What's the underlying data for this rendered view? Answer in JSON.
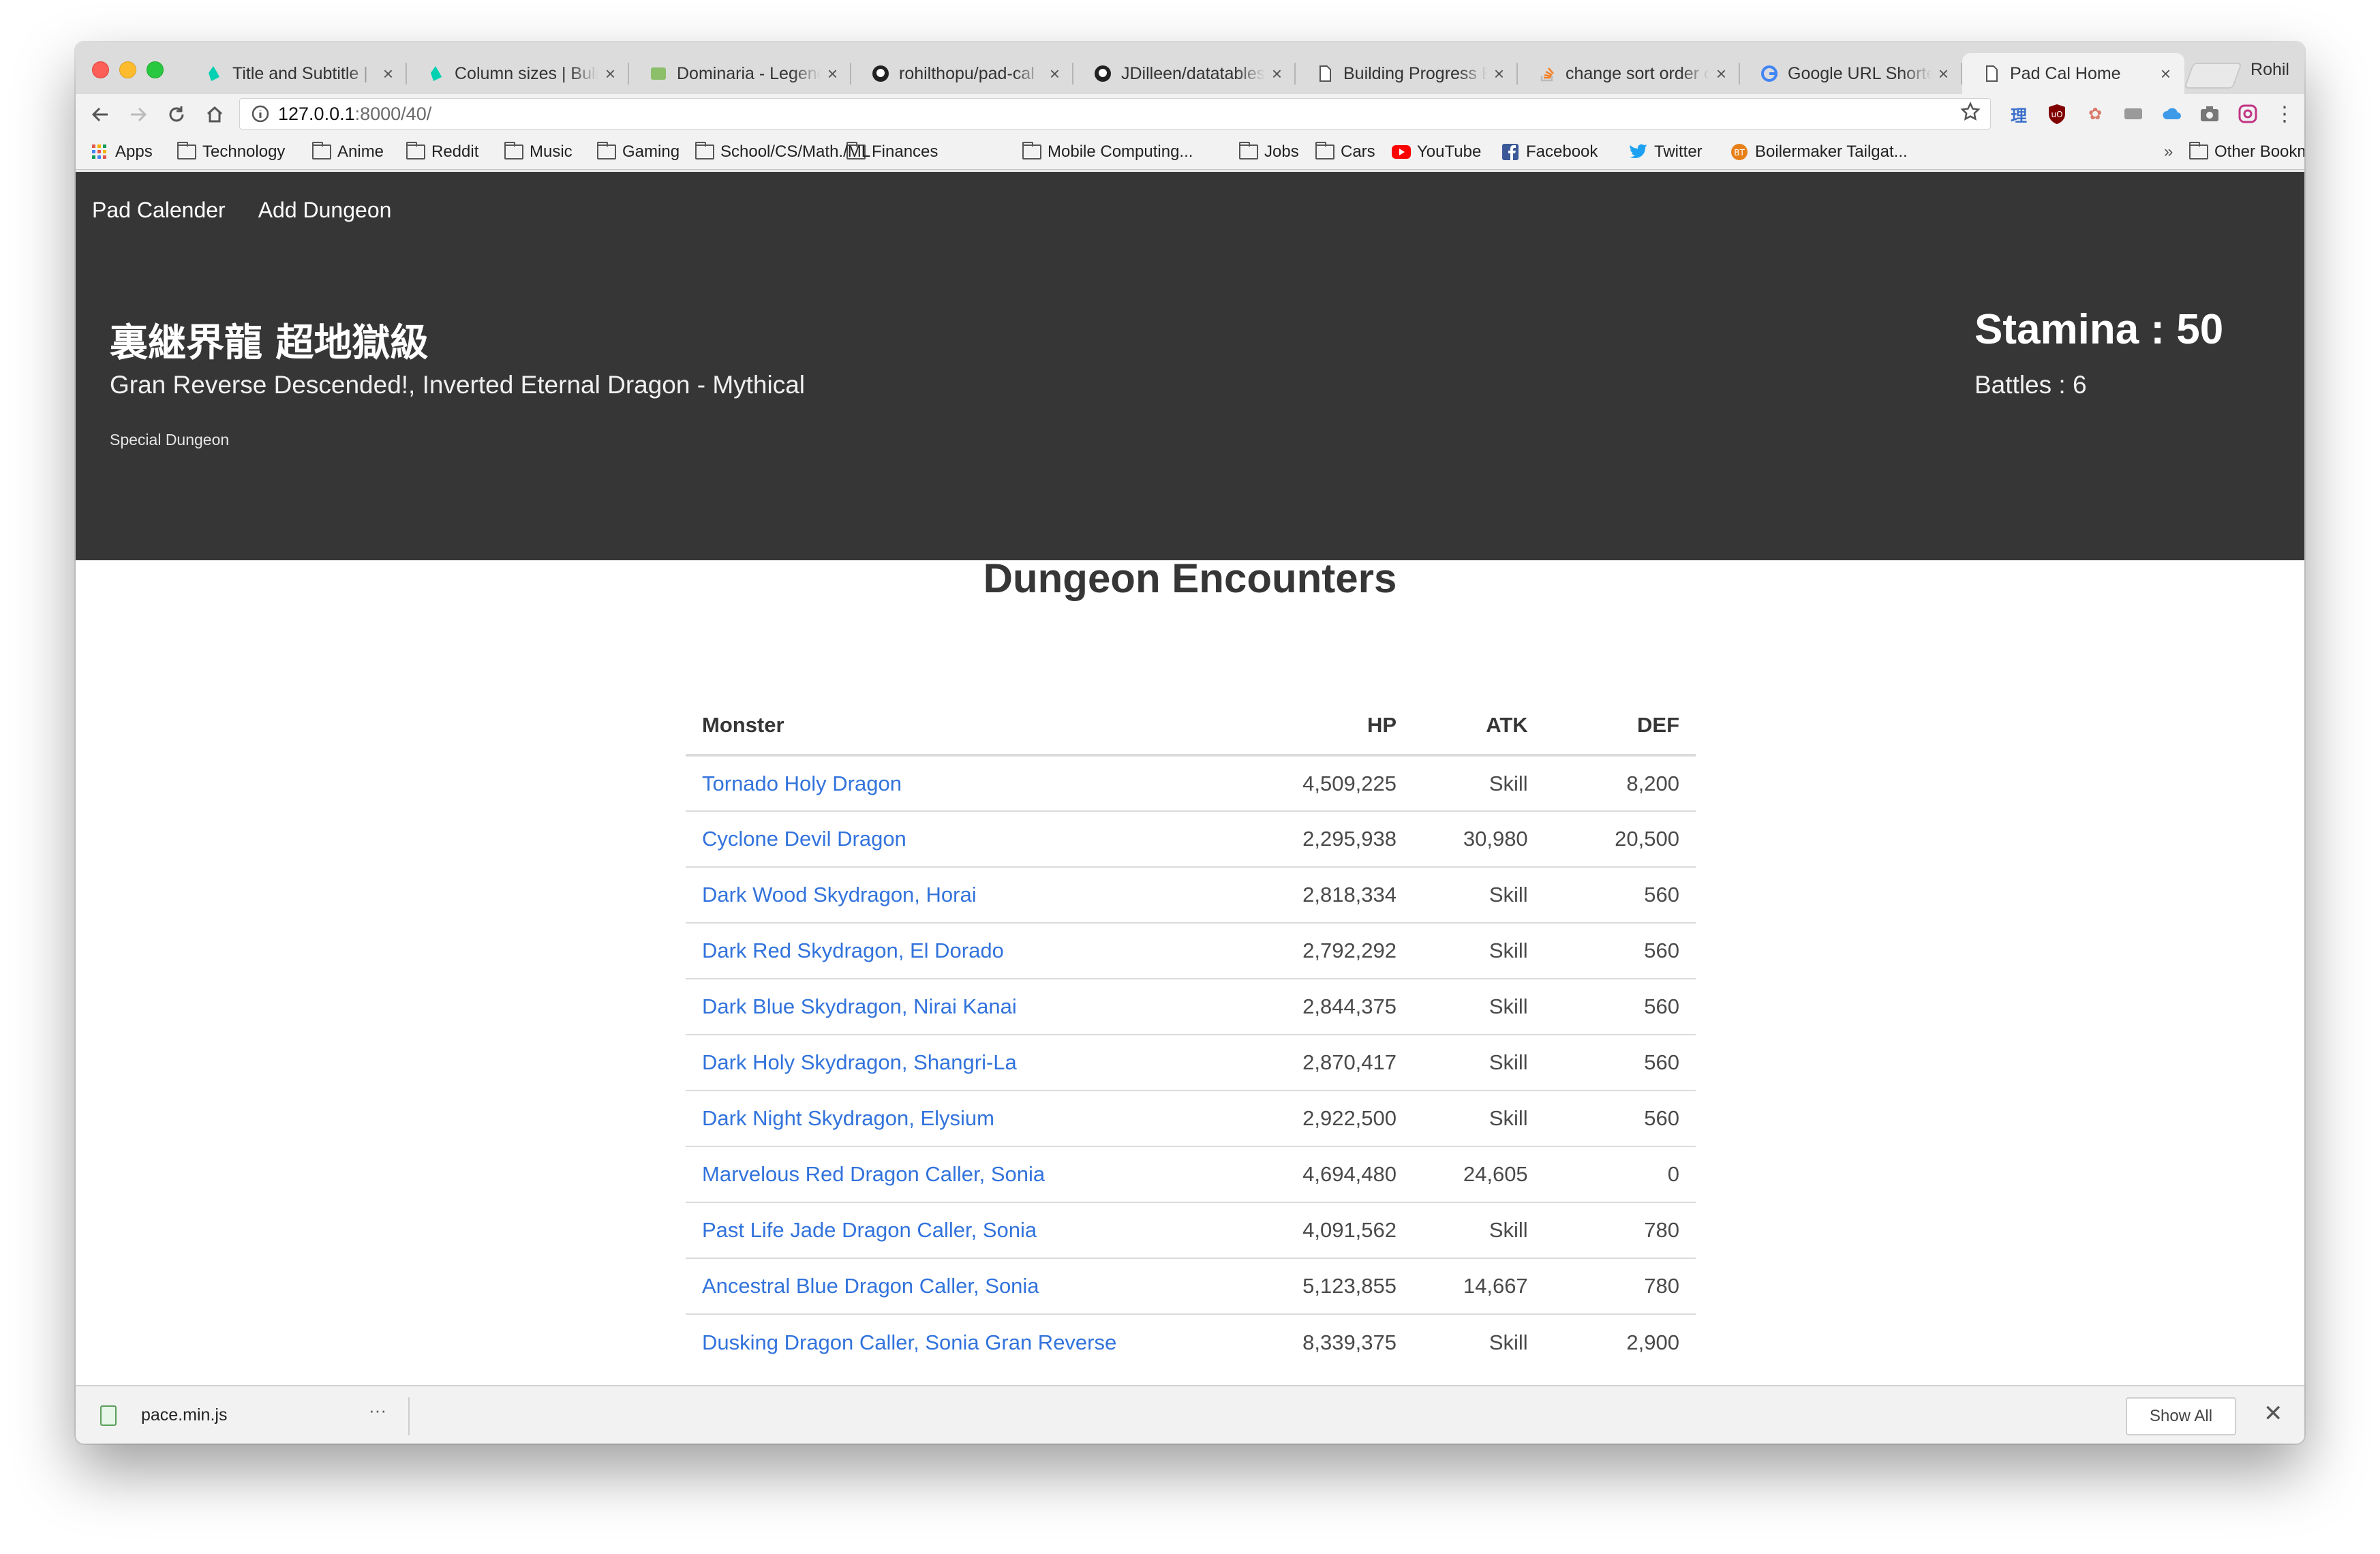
{
  "browser": {
    "profile_name": "Rohil",
    "tabs": [
      {
        "label": "Title and Subtitle |",
        "icon": "bulma-icon",
        "active": false
      },
      {
        "label": "Column sizes | Bulr",
        "icon": "bulma-icon",
        "active": false
      },
      {
        "label": "Dominaria - Legenc",
        "icon": "card-icon",
        "active": false
      },
      {
        "label": "rohilthopu/pad-cal",
        "icon": "github-icon",
        "active": false
      },
      {
        "label": "JDilleen/datatables",
        "icon": "github-icon",
        "active": false
      },
      {
        "label": "Building Progress E",
        "icon": "document-icon",
        "active": false
      },
      {
        "label": "change sort order c",
        "icon": "stackoverflow-icon",
        "active": false
      },
      {
        "label": "Google URL Shorte",
        "icon": "google-icon",
        "active": false
      },
      {
        "label": "Pad Cal Home",
        "icon": "document-icon",
        "active": true
      }
    ],
    "url_host": "127.0.0.1",
    "url_path": ":8000/40/",
    "bookmarks": [
      {
        "label": "Apps",
        "icon": "apps-grid-icon"
      },
      {
        "label": "Technology",
        "icon": "folder-icon"
      },
      {
        "label": "Anime",
        "icon": "folder-icon"
      },
      {
        "label": "Reddit",
        "icon": "folder-icon"
      },
      {
        "label": "Music",
        "icon": "folder-icon"
      },
      {
        "label": "Gaming",
        "icon": "folder-icon"
      },
      {
        "label": "School/CS/Math./ML",
        "icon": "folder-icon"
      },
      {
        "label": "Finances",
        "icon": "folder-icon"
      },
      {
        "label": "Mobile Computing...",
        "icon": "folder-icon"
      },
      {
        "label": "Jobs",
        "icon": "folder-icon"
      },
      {
        "label": "Cars",
        "icon": "folder-icon"
      },
      {
        "label": "YouTube",
        "icon": "youtube-icon"
      },
      {
        "label": "Facebook",
        "icon": "facebook-icon"
      },
      {
        "label": "Twitter",
        "icon": "twitter-icon"
      },
      {
        "label": "Boilermaker Tailgat...",
        "icon": "boilermaker-icon"
      }
    ],
    "bookmarks_overflow": "»",
    "other_bookmarks": "Other Bookmarks"
  },
  "nav": {
    "pad_calender": "Pad Calender",
    "add_dungeon": "Add Dungeon"
  },
  "hero": {
    "jp_title": "裏継界龍 超地獄級",
    "en_title": "Gran Reverse Descended!, Inverted Eternal Dragon - Mythical",
    "dungeon_type": "Special Dungeon",
    "stamina": "Stamina : 50",
    "battles": "Battles : 6"
  },
  "encounters": {
    "title": "Dungeon Encounters",
    "columns": [
      "Monster",
      "HP",
      "ATK",
      "DEF"
    ],
    "rows": [
      {
        "monster": "Tornado Holy Dragon",
        "hp": "4,509,225",
        "atk": "Skill",
        "def": "8,200"
      },
      {
        "monster": "Cyclone Devil Dragon",
        "hp": "2,295,938",
        "atk": "30,980",
        "def": "20,500"
      },
      {
        "monster": "Dark Wood Skydragon, Horai",
        "hp": "2,818,334",
        "atk": "Skill",
        "def": "560"
      },
      {
        "monster": "Dark Red Skydragon, El Dorado",
        "hp": "2,792,292",
        "atk": "Skill",
        "def": "560"
      },
      {
        "monster": "Dark Blue Skydragon, Nirai Kanai",
        "hp": "2,844,375",
        "atk": "Skill",
        "def": "560"
      },
      {
        "monster": "Dark Holy Skydragon, Shangri-La",
        "hp": "2,870,417",
        "atk": "Skill",
        "def": "560"
      },
      {
        "monster": "Dark Night Skydragon, Elysium",
        "hp": "2,922,500",
        "atk": "Skill",
        "def": "560"
      },
      {
        "monster": "Marvelous Red Dragon Caller, Sonia",
        "hp": "4,694,480",
        "atk": "24,605",
        "def": "0"
      },
      {
        "monster": "Past Life Jade Dragon Caller, Sonia",
        "hp": "4,091,562",
        "atk": "Skill",
        "def": "780"
      },
      {
        "monster": "Ancestral Blue Dragon Caller, Sonia",
        "hp": "5,123,855",
        "atk": "14,667",
        "def": "780"
      },
      {
        "monster": "Dusking Dragon Caller, Sonia Gran Reverse",
        "hp": "8,339,375",
        "atk": "Skill",
        "def": "2,900"
      }
    ]
  },
  "download_shelf": {
    "file_name": "pace.min.js",
    "more": "···",
    "show_all": "Show All",
    "close": "✕"
  },
  "colors": {
    "hero_bg": "#363636",
    "link": "#3273dc",
    "text": "#4a4a4a"
  }
}
